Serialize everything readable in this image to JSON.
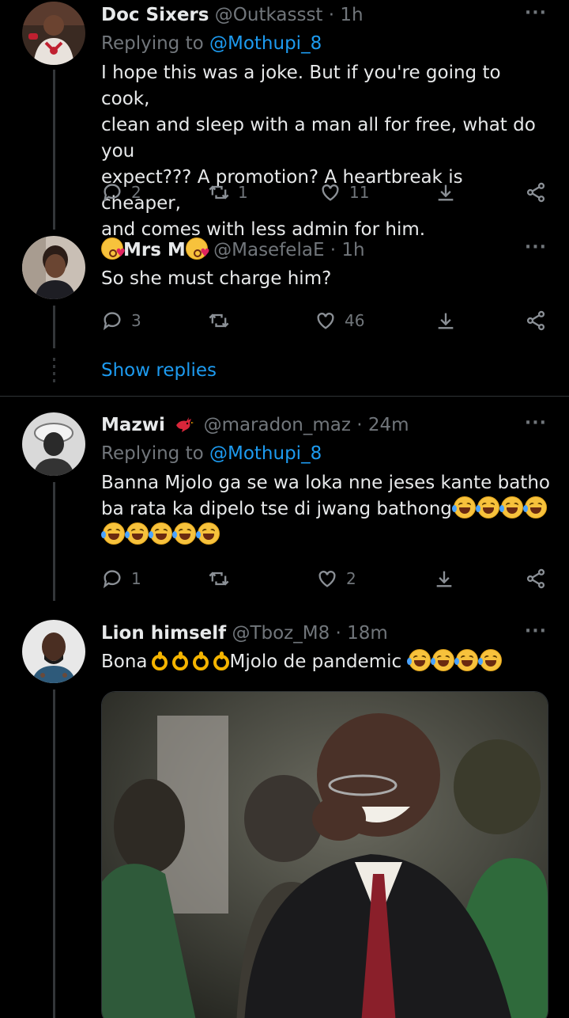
{
  "tweets": [
    {
      "name": "Doc Sixers",
      "handle": "@Outkassst",
      "time": "1h",
      "replying_prefix": "Replying to",
      "replying_to": "@Mothupi_8",
      "text_lines": [
        "I hope this was a joke. But if you're going to cook,",
        "clean and sleep with a man all for free, what do you",
        "expect??? A promotion? A heartbreak is cheaper,",
        "and comes with less admin for him."
      ],
      "replies": "2",
      "retweets": "1",
      "likes": "11"
    },
    {
      "name": "Mrs M",
      "handle": "@MasefelaE",
      "time": "1h",
      "text": "So she must charge him?",
      "replies": "3",
      "retweets": "",
      "likes": "46",
      "show_replies": "Show replies"
    },
    {
      "name": "Mazwi",
      "handle": "@maradon_maz",
      "time": "24m",
      "replying_prefix": "Replying to",
      "replying_to": "@Mothupi_8",
      "text_line1": "Banna Mjolo ga se wa loka nne jeses kante batho",
      "text_line2": "ba rata ka dipelo tse di jwang bathong",
      "replies": "1",
      "retweets": "",
      "likes": "2"
    },
    {
      "name": "Lion himself",
      "handle": "@Tboz_M8",
      "time": "18m",
      "text_a": "Bona",
      "text_b": "Mjolo de pandemic"
    }
  ],
  "separator": "·",
  "more_label": "···",
  "icons": [
    "reply-icon",
    "retweet-icon",
    "like-icon",
    "save-icon",
    "share-icon",
    "more-icon"
  ],
  "colors": {
    "background": "#000000",
    "link": "#1d9bf0",
    "muted": "#71767b",
    "text": "#e7e9ea"
  }
}
